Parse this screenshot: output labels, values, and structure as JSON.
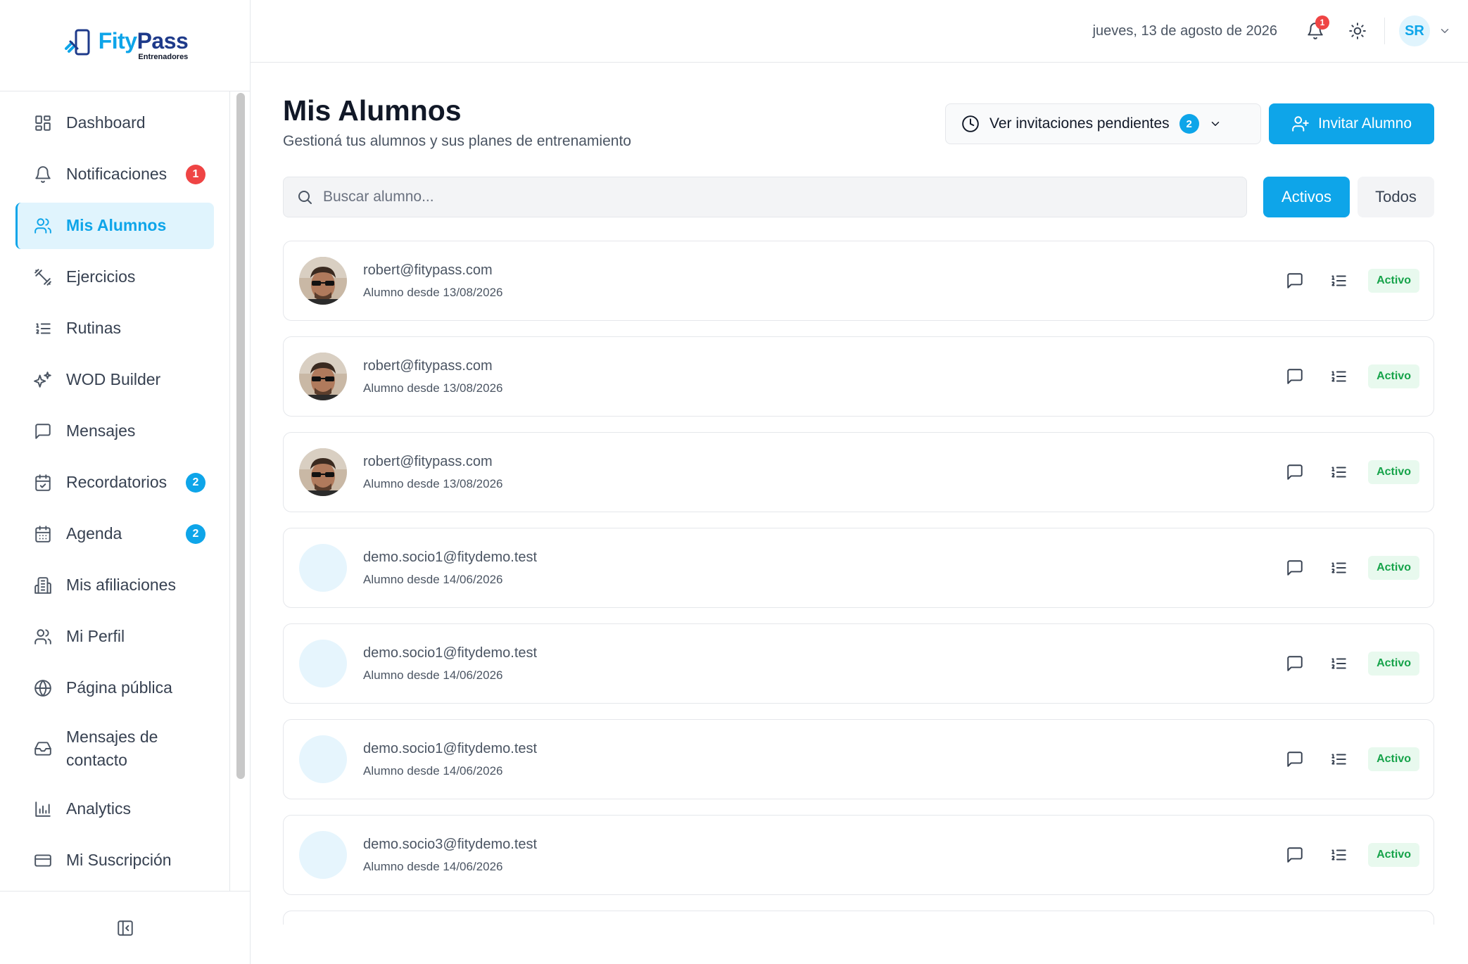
{
  "brand": {
    "name_part1": "Fity",
    "name_part2": "Pass",
    "subtitle": "Entrenadores"
  },
  "sidebar": {
    "items": [
      {
        "label": "Dashboard",
        "icon": "dashboard-icon",
        "badge": null
      },
      {
        "label": "Notificaciones",
        "icon": "bell-icon",
        "badge": "1",
        "badge_color": "#ef4444"
      },
      {
        "label": "Mis Alumnos",
        "icon": "users-icon",
        "badge": null,
        "active": true
      },
      {
        "label": "Ejercicios",
        "icon": "dumbbell-icon",
        "badge": null
      },
      {
        "label": "Rutinas",
        "icon": "list-ordered-icon",
        "badge": null
      },
      {
        "label": "WOD Builder",
        "icon": "sparkles-icon",
        "badge": null
      },
      {
        "label": "Mensajes",
        "icon": "message-icon",
        "badge": null
      },
      {
        "label": "Recordatorios",
        "icon": "calendar-check-icon",
        "badge": "2",
        "badge_color": "#0ea5e9"
      },
      {
        "label": "Agenda",
        "icon": "calendar-icon",
        "badge": "2",
        "badge_color": "#0ea5e9"
      },
      {
        "label": "Mis afiliaciones",
        "icon": "building-icon",
        "badge": null
      },
      {
        "label": "Mi Perfil",
        "icon": "user-icon",
        "badge": null
      },
      {
        "label": "Página pública",
        "icon": "globe-icon",
        "badge": null
      },
      {
        "label": "Mensajes de contacto",
        "icon": "inbox-icon",
        "badge": null
      },
      {
        "label": "Analytics",
        "icon": "bar-chart-icon",
        "badge": null
      },
      {
        "label": "Mi Suscripción",
        "icon": "credit-card-icon",
        "badge": null
      }
    ]
  },
  "header": {
    "date": "jueves, 13 de agosto de 2026",
    "notification_count": "1",
    "user_initials": "SR"
  },
  "page": {
    "title": "Mis Alumnos",
    "subtitle": "Gestioná tus alumnos y sus planes de entrenamiento",
    "pending_label": "Ver invitaciones pendientes",
    "pending_count": "2",
    "invite_label": "Invitar Alumno",
    "search_placeholder": "Buscar alumno...",
    "filter_active": "Activos",
    "filter_all": "Todos"
  },
  "students": [
    {
      "email": "robert@fitypass.com",
      "since": "Alumno desde 13/08/2026",
      "status": "Activo",
      "has_photo": true
    },
    {
      "email": "robert@fitypass.com",
      "since": "Alumno desde 13/08/2026",
      "status": "Activo",
      "has_photo": true
    },
    {
      "email": "robert@fitypass.com",
      "since": "Alumno desde 13/08/2026",
      "status": "Activo",
      "has_photo": true
    },
    {
      "email": "demo.socio1@fitydemo.test",
      "since": "Alumno desde 14/06/2026",
      "status": "Activo",
      "has_photo": false
    },
    {
      "email": "demo.socio1@fitydemo.test",
      "since": "Alumno desde 14/06/2026",
      "status": "Activo",
      "has_photo": false
    },
    {
      "email": "demo.socio1@fitydemo.test",
      "since": "Alumno desde 14/06/2026",
      "status": "Activo",
      "has_photo": false
    },
    {
      "email": "demo.socio3@fitydemo.test",
      "since": "Alumno desde 14/06/2026",
      "status": "Activo",
      "has_photo": false
    }
  ],
  "colors": {
    "accent": "#0ea5e9",
    "danger": "#ef4444",
    "success": "#16a34a"
  }
}
